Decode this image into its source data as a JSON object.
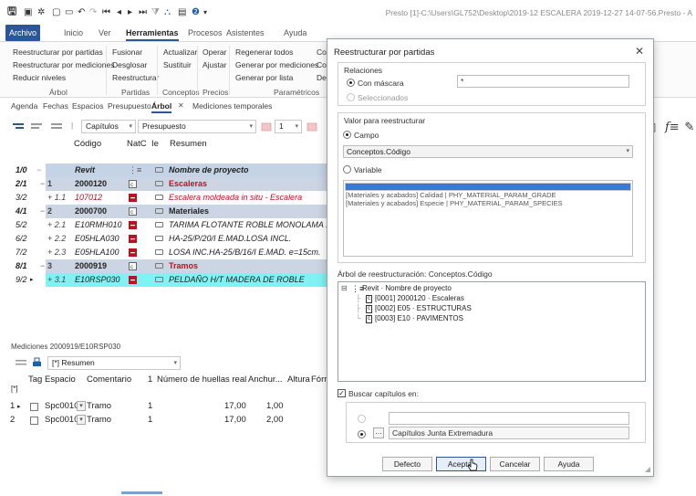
{
  "window": {
    "title": "Presto [1]-C:\\Users\\GL752\\Desktop\\2019-12 ESCALERA 2019-12-27 14-07-56.Presto - A"
  },
  "ribbon": {
    "tabs": [
      "Archivo",
      "Inicio",
      "Ver",
      "Herramientas",
      "Procesos",
      "Asistentes",
      "Ayuda"
    ],
    "groups": {
      "arbol": {
        "label": "Árbol",
        "items": [
          "Reestructurar por partidas",
          "Reestructurar por mediciones",
          "Reducir niveles"
        ]
      },
      "partidas": {
        "label": "Partidas",
        "items": [
          "Fusionar",
          "Desglosar",
          "Reestructurar"
        ]
      },
      "conceptos": {
        "label": "Conceptos",
        "items": [
          "Actualizar",
          "Sustituir"
        ]
      },
      "precios": {
        "label": "Precios",
        "items": [
          "Operar",
          "Ajustar"
        ]
      },
      "parametricos": {
        "label": "Paramétricos",
        "items": [
          "Regenerar todos",
          "Generar por mediciones",
          "Generar por lista"
        ]
      },
      "extra": {
        "items": [
          "Co",
          "Co",
          "De"
        ]
      }
    }
  },
  "subtabs": [
    "Agenda",
    "Fechas",
    "Espacios",
    "Presupuesto",
    "Árbol",
    "Mediciones temporales"
  ],
  "toolbar": {
    "capitulos": "Capítulos",
    "presupuesto": "Presupuesto",
    "level": "1"
  },
  "grid": {
    "headers": {
      "codigo": "Código",
      "natc": "NatC",
      "ie": "Ie",
      "resumen": "Resumen"
    },
    "rows": [
      {
        "num": "1/0",
        "lvl": "",
        "code": "Revit",
        "resumen": "Nombre de proyecto"
      },
      {
        "num": "2/1",
        "lvl": "1",
        "code": "2000120",
        "resumen": "Escaleras"
      },
      {
        "num": "3/2",
        "lvl": "+ 1.1",
        "code": "107012",
        "resumen": "Escalera moldeada in situ - Escalera"
      },
      {
        "num": "4/1",
        "lvl": "2",
        "code": "2000700",
        "resumen": "Materiales"
      },
      {
        "num": "5/2",
        "lvl": "+ 2.1",
        "code": "E10RMH010",
        "resumen": "TARIMA FLOTANTE ROBLE MONOLAMA 1"
      },
      {
        "num": "6/2",
        "lvl": "+ 2.2",
        "code": "E05HLA030",
        "resumen": "HA-25/P/20/I E.MAD.LOSA INCL."
      },
      {
        "num": "7/2",
        "lvl": "+ 2.3",
        "code": "E05HLA100",
        "resumen": "LOSA INC.HA-25/B/16/I E.MAD. e=15cm."
      },
      {
        "num": "8/1",
        "lvl": "3",
        "code": "2000919",
        "resumen": "Tramos"
      },
      {
        "num": "9/2",
        "lvl": "+ 3.1",
        "code": "E10RSP030",
        "resumen": "PELDAÑO H/T MADERA DE ROBLE"
      }
    ]
  },
  "mediciones": {
    "title": "Mediciones 2000919/E10RSP030",
    "filter": "[*] Resumen",
    "headers": {
      "star": "[*]",
      "tag": "Tag",
      "espacio": "Espacio",
      "comentario": "Comentario",
      "n": "1",
      "huellas": "Número de huellas real",
      "anchura": "Anchur...",
      "altura": "Altura",
      "formula": "Fórr"
    },
    "rows": [
      {
        "idx": "1",
        "espacio": "Spc0010",
        "comentario": "Tramo",
        "n": "1",
        "huellas": "17,00",
        "anchura": "1,00"
      },
      {
        "idx": "2",
        "espacio": "Spc0010",
        "comentario": "Tramo",
        "n": "1",
        "huellas": "17,00",
        "anchura": "2,00"
      }
    ]
  },
  "dialog": {
    "title": "Reestructurar por partidas",
    "relaciones": {
      "label": "Relaciones",
      "con_mascara": "Con máscara",
      "mask_value": "*",
      "seleccionados": "Seleccionados"
    },
    "valor": {
      "label": "Valor para reestructurar",
      "campo": "Campo",
      "campo_value": "Conceptos.Código",
      "variable": "Variable",
      "variables": [
        "",
        "[Materiales y acabados] Calidad | PHY_MATERIAL_PARAM_GRADE",
        "[Materiales y acabados] Especie | PHY_MATERIAL_PARAM_SPECIES"
      ]
    },
    "arbol": {
      "label": "Árbol de reestructuración: Conceptos.Código",
      "root": "Revit · Nombre de proyecto",
      "nodes": [
        "[0001] 2000120 · Escaleras",
        "[0002] E05 · ESTRUCTURAS",
        "[0003] E10 · PAVIMENTOS"
      ]
    },
    "buscar": {
      "label": "Buscar capítulos en:",
      "option2": "Capítulos Junta Extremadura"
    },
    "buttons": {
      "defecto": "Defecto",
      "aceptar": "Aceptar",
      "cancelar": "Cancelar",
      "ayuda": "Ayuda"
    }
  }
}
